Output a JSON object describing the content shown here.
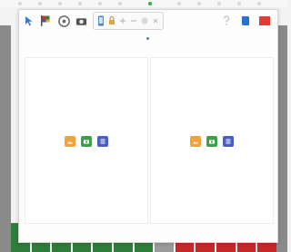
{
  "colors": {
    "modal_bg": "#fdfdfd",
    "image_button": "#f2a23c",
    "camera_button": "#3f9f4a",
    "list_button": "#4a5fc4",
    "bottom_tiles": [
      "#2e7d3a",
      "#2e7d3a",
      "#2e7d3a",
      "#2e7d3a",
      "#2e7d3a",
      "#2e7d3a",
      "#2e7d3a",
      "#9a9a9a",
      "#c62828",
      "#c62828",
      "#c62828",
      "#c62828",
      "#c62828"
    ]
  },
  "toolbar": {
    "left_icons": [
      "pointer-icon",
      "flag-icon",
      "palette-icon",
      "camera-icon"
    ],
    "group_icons": [
      "phone-icon",
      "lock-icon",
      "plus-icon",
      "minus-icon",
      "circle-icon",
      "close-icon"
    ],
    "right_icons": [
      "help-icon",
      "book-icon",
      "exit-icon"
    ]
  },
  "panels": [
    {
      "actions": [
        "image-icon",
        "camera-icon",
        "list-icon"
      ]
    },
    {
      "actions": [
        "image-icon",
        "camera-icon",
        "list-icon"
      ]
    }
  ]
}
